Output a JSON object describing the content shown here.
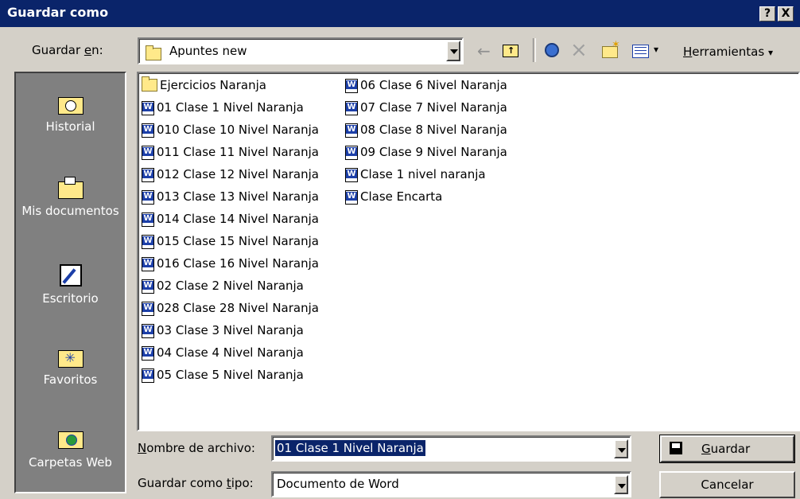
{
  "title": "Guardar como",
  "title_buttons": {
    "help": "?",
    "close": "X"
  },
  "save_in": {
    "label_pre": "Guardar ",
    "label_u": "e",
    "label_post": "n:",
    "value": "Apuntes new"
  },
  "toolbar": {
    "tools_pre": "",
    "tools_u": "H",
    "tools_post": "erramientas",
    "tools_arrow": "▾",
    "views_arrow": "▾"
  },
  "places": [
    {
      "label": "Historial",
      "icon": "history-icon"
    },
    {
      "label": "Mis documentos",
      "icon": "my-documents-icon"
    },
    {
      "label": "Escritorio",
      "icon": "desktop-icon"
    },
    {
      "label": "Favoritos",
      "icon": "favorites-icon"
    },
    {
      "label": "Carpetas Web",
      "icon": "web-folders-icon"
    }
  ],
  "files": [
    {
      "name": "Ejercicios Naranja",
      "type": "folder"
    },
    {
      "name": "01 Clase 1 Nivel Naranja",
      "type": "doc"
    },
    {
      "name": "010 Clase 10 Nivel Naranja",
      "type": "doc"
    },
    {
      "name": "011 Clase 11 Nivel Naranja",
      "type": "doc"
    },
    {
      "name": "012 Clase 12 Nivel Naranja",
      "type": "doc"
    },
    {
      "name": "013 Clase 13 Nivel Naranja",
      "type": "doc"
    },
    {
      "name": "014 Clase 14 Nivel Naranja",
      "type": "doc"
    },
    {
      "name": "015 Clase 15 Nivel Naranja",
      "type": "doc"
    },
    {
      "name": "016 Clase 16 Nivel Naranja",
      "type": "doc"
    },
    {
      "name": "02 Clase 2 Nivel Naranja",
      "type": "doc"
    },
    {
      "name": "028 Clase 28 Nivel Naranja",
      "type": "doc"
    },
    {
      "name": "03 Clase 3 Nivel Naranja",
      "type": "doc"
    },
    {
      "name": "04 Clase 4 Nivel Naranja",
      "type": "doc"
    },
    {
      "name": "05 Clase 5 Nivel Naranja",
      "type": "doc"
    },
    {
      "name": "06 Clase 6 Nivel Naranja",
      "type": "doc"
    },
    {
      "name": "07 Clase 7 Nivel Naranja",
      "type": "doc"
    },
    {
      "name": "08 Clase 8 Nivel Naranja",
      "type": "doc"
    },
    {
      "name": "09 Clase 9 Nivel Naranja",
      "type": "doc"
    },
    {
      "name": "Clase 1 nivel naranja",
      "type": "doc"
    },
    {
      "name": "Clase Encarta",
      "type": "doc"
    }
  ],
  "filename": {
    "label_pre": "",
    "label_u": "N",
    "label_post": "ombre de archivo:",
    "value": "01 Clase 1 Nivel Naranja"
  },
  "filetype": {
    "label_pre": "Guardar como ",
    "label_u": "t",
    "label_post": "ipo:",
    "value": "Documento de Word"
  },
  "buttons": {
    "save_pre": "",
    "save_u": "G",
    "save_post": "uardar",
    "cancel": "Cancelar"
  },
  "colors": {
    "titlebar": "#0a246a",
    "selection": "#0a246a",
    "face": "#d4d0c8"
  }
}
